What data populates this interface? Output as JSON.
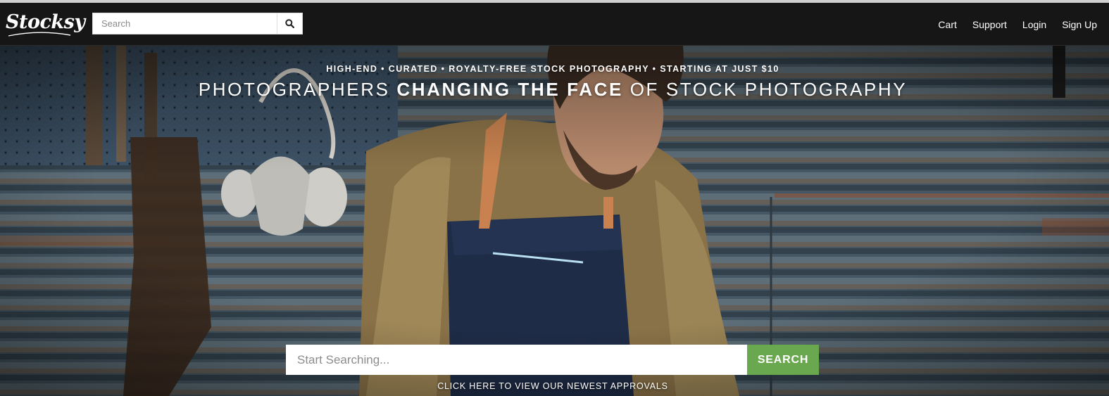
{
  "header": {
    "logo_text": "Stocksy",
    "search": {
      "placeholder": "Search",
      "value": ""
    },
    "search_icon": "magnifier-icon",
    "links": [
      "Cart",
      "Support",
      "Login",
      "Sign Up"
    ]
  },
  "hero": {
    "tagline": "HIGH-END • CURATED • ROYALTY-FREE STOCK PHOTOGRAPHY • STARTING AT JUST $10",
    "headline_part1": "PHOTOGRAPHERS ",
    "headline_bold": "CHANGING THE FACE",
    "headline_part2": " OF STOCK PHOTOGRAPHY",
    "search": {
      "placeholder": "Start Searching...",
      "value": ""
    },
    "search_button": "SEARCH",
    "approvals_link": "CLICK HERE TO VIEW OUR NEWEST APPROVALS"
  },
  "colors": {
    "nav_background": "#161616",
    "search_button": "#6aa84f"
  }
}
